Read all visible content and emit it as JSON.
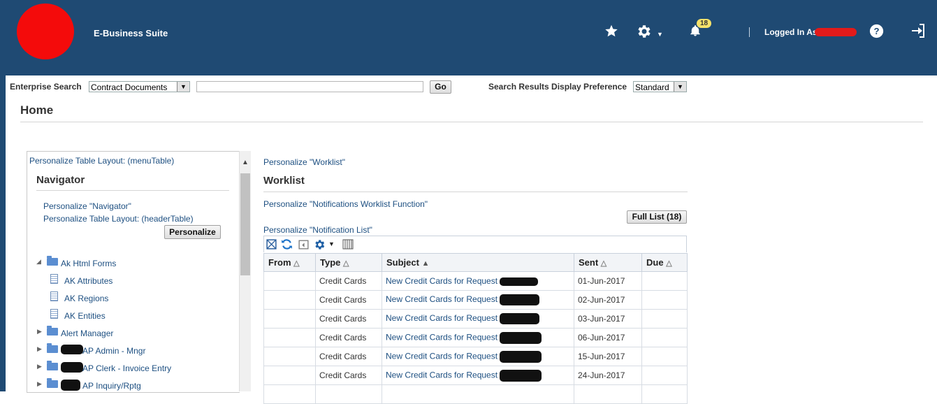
{
  "header": {
    "app_title": "E-Business Suite",
    "notification_count": "18",
    "logged_in_label": "Logged In As",
    "icons": [
      "favorites-star-icon",
      "settings-gear-icon",
      "notifications-bell-icon",
      "help-icon",
      "logout-icon"
    ],
    "bar_color": "#1f4a73"
  },
  "search": {
    "label": "Enterprise Search",
    "category_value": "Contract Documents",
    "query_value": "",
    "go_label": "Go",
    "pref_label": "Search Results Display Preference",
    "pref_value": "Standard"
  },
  "page": {
    "title": "Home"
  },
  "navigator": {
    "personalize_table_link": "Personalize Table Layout: (menuTable)",
    "title": "Navigator",
    "personalize_nav_link": "Personalize \"Navigator\"",
    "personalize_header_link": "Personalize Table Layout: (headerTable)",
    "personalize_button": "Personalize",
    "tree": [
      {
        "label": "Ak Html Forms",
        "type": "folder",
        "expanded": true
      },
      {
        "label": "AK Attributes",
        "type": "function"
      },
      {
        "label": "AK Regions",
        "type": "function"
      },
      {
        "label": "AK Entities",
        "type": "function"
      },
      {
        "label": "Alert Manager",
        "type": "folder",
        "expanded": false
      },
      {
        "label": "AP Admin - Mngr",
        "type": "folder",
        "expanded": false
      },
      {
        "label": "AP Clerk - Invoice Entry",
        "type": "folder",
        "expanded": false
      },
      {
        "label": "AP Inquiry/Rptg",
        "type": "folder",
        "expanded": false
      }
    ]
  },
  "worklist": {
    "personalize_worklist_link": "Personalize \"Worklist\"",
    "title": "Worklist",
    "personalize_function_link": "Personalize \"Notifications Worklist Function\"",
    "full_list_button": "Full List (18)",
    "personalize_list_link": "Personalize \"Notification List\"",
    "columns": [
      "From",
      "Type",
      "Subject",
      "Sent",
      "Due"
    ],
    "rows": [
      {
        "from": "",
        "type": "Credit Cards",
        "subject": "New Credit Cards for Request",
        "sent": "01-Jun-2017",
        "due": ""
      },
      {
        "from": "",
        "type": "Credit Cards",
        "subject": "New Credit Cards for Request",
        "sent": "02-Jun-2017",
        "due": ""
      },
      {
        "from": "",
        "type": "Credit Cards",
        "subject": "New Credit Cards for Request",
        "sent": "03-Jun-2017",
        "due": ""
      },
      {
        "from": "",
        "type": "Credit Cards",
        "subject": "New Credit Cards for Request",
        "sent": "06-Jun-2017",
        "due": ""
      },
      {
        "from": "",
        "type": "Credit Cards",
        "subject": "New Credit Cards for Request",
        "sent": "15-Jun-2017",
        "due": ""
      },
      {
        "from": "",
        "type": "Credit Cards",
        "subject": "New Credit Cards for Request",
        "sent": "24-Jun-2017",
        "due": ""
      }
    ]
  }
}
